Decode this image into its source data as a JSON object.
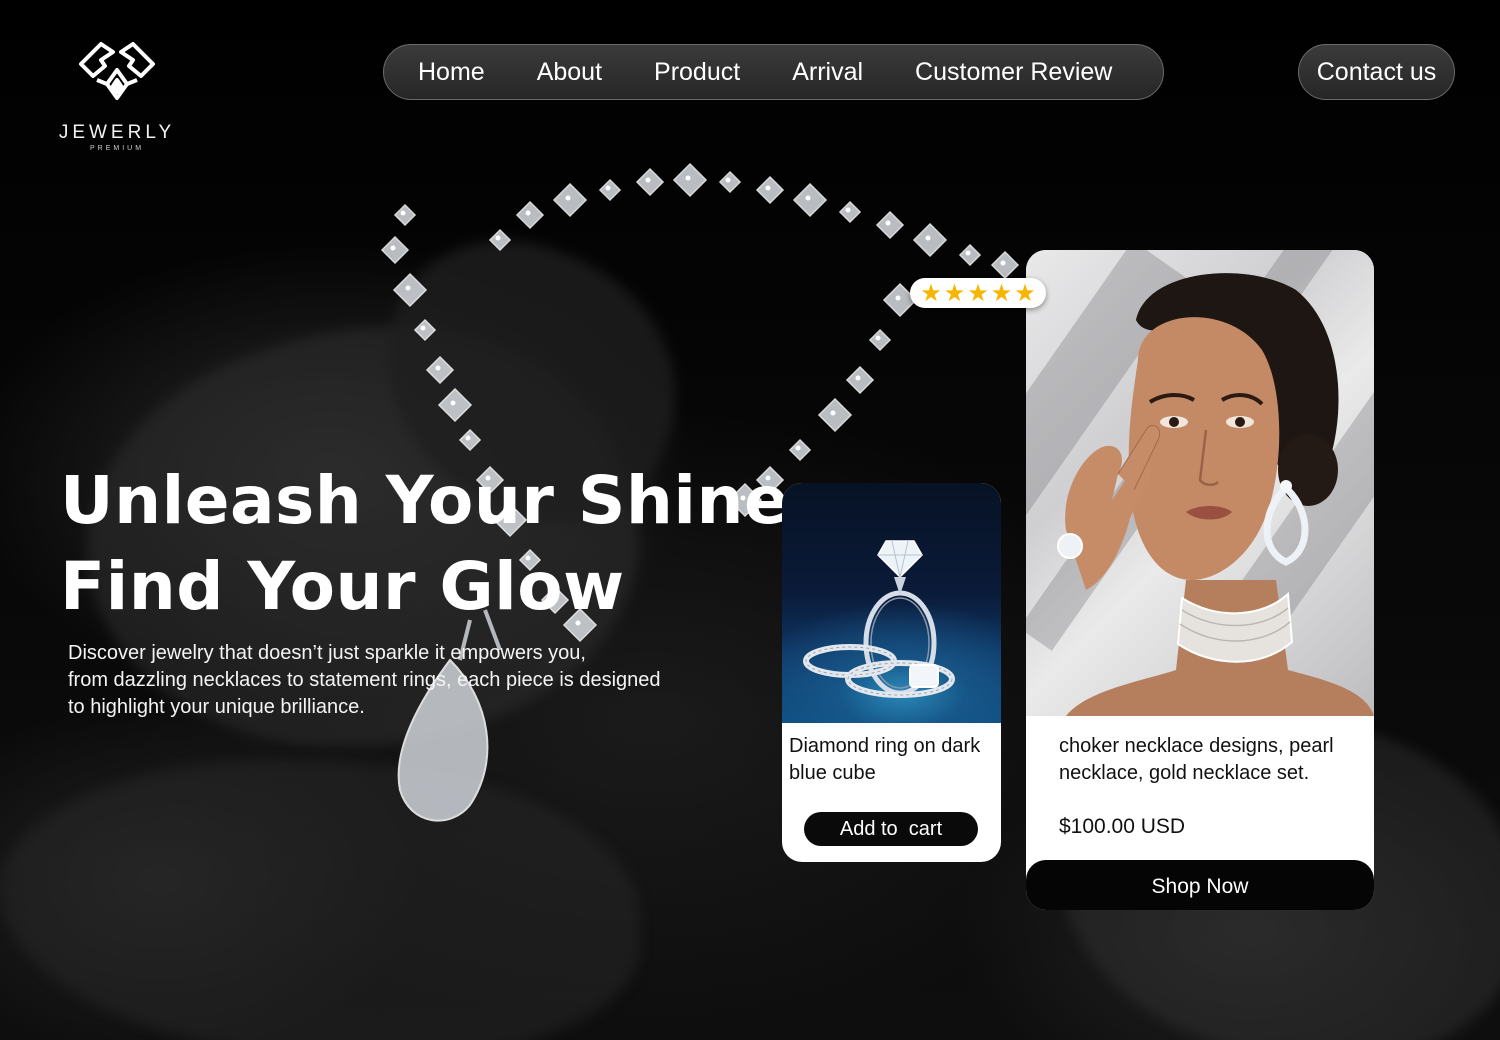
{
  "brand": {
    "name": "JEWERLY",
    "tagline": "PREMIUM",
    "logo_icon": "diamond-logo-icon"
  },
  "nav": {
    "items": [
      {
        "label": "Home"
      },
      {
        "label": "About"
      },
      {
        "label": "Product"
      },
      {
        "label": "Arrival"
      },
      {
        "label": "Customer Review"
      }
    ],
    "contact_label": "Contact us"
  },
  "hero": {
    "title_line1": "Unleash Your Shine,",
    "title_line2": "Find Your Glow",
    "description_lines": [
      "Discover jewelry that doesn’t just sparkle it empowers you,",
      "from dazzling necklaces to statement rings, each piece is designed",
      "to highlight your unique brilliance."
    ]
  },
  "rating": {
    "stars": 5,
    "max": 5,
    "star_color": "#f7b500"
  },
  "products": {
    "ring": {
      "title_lines": [
        "Diamond ring on dark",
        "blue cube"
      ],
      "button_label": "Add to  cart"
    },
    "necklace": {
      "title_lines": [
        "choker necklace designs, pearl",
        "necklace, gold necklace set."
      ],
      "price": "$100.00 USD",
      "button_label": "Shop Now"
    }
  },
  "colors": {
    "background": "#050505",
    "accent_star": "#f7b500",
    "button_dark": "#0a0a0a",
    "card": "#ffffff"
  }
}
